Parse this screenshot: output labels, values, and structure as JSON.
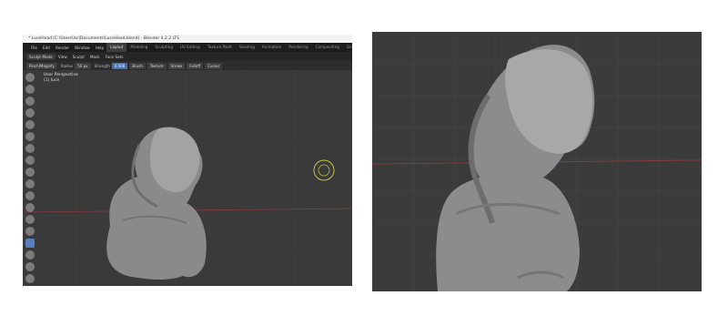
{
  "left_window": {
    "title": "* LuceHead [C:\\Users\\lsc\\Documents\\LuceHead.blend] - Blender 4.2.2 LTS",
    "top_menu": [
      {
        "label": "File"
      },
      {
        "label": "Edit"
      },
      {
        "label": "Render"
      },
      {
        "label": "Window"
      },
      {
        "label": "Help"
      }
    ],
    "workspace_tabs": [
      {
        "label": "Layout",
        "active": true
      },
      {
        "label": "Modeling",
        "active": false
      },
      {
        "label": "Sculpting",
        "active": false
      },
      {
        "label": "UV Editing",
        "active": false
      },
      {
        "label": "Texture Paint",
        "active": false
      },
      {
        "label": "Shading",
        "active": false
      },
      {
        "label": "Animation",
        "active": false
      },
      {
        "label": "Rendering",
        "active": false
      },
      {
        "label": "Compositing",
        "active": false
      },
      {
        "label": "Geometry Nodes",
        "active": false
      }
    ],
    "header": {
      "mode": "Sculpt Mode",
      "menus": [
        {
          "label": "View"
        },
        {
          "label": "Sculpt"
        },
        {
          "label": "Mask"
        },
        {
          "label": "Face Sets"
        }
      ]
    },
    "tool_settings": {
      "brush_name": "Pinch/Magnify",
      "radius_label": "Radius",
      "radius_value": "50 px",
      "strength_label": "Strength",
      "strength_value": "0.500",
      "dropdowns": [
        {
          "label": "Brush"
        },
        {
          "label": "Texture"
        },
        {
          "label": "Stroke"
        },
        {
          "label": "Falloff"
        },
        {
          "label": "Cursor"
        }
      ]
    },
    "viewport": {
      "view_name": "User Perspective",
      "object_name": "(1) luce"
    },
    "colors": {
      "accent": "#4772b3",
      "blender_orange": "#e87d0d",
      "viewport_bg": "#3a3a3a",
      "brush_cursor": "#c8c04a",
      "x_axis": "#8a3a3a"
    },
    "sculpt_tools": [
      {
        "icon": "draw-brush-icon",
        "active": false
      },
      {
        "icon": "draw-sharp-brush-icon",
        "active": false
      },
      {
        "icon": "clay-brush-icon",
        "active": false
      },
      {
        "icon": "clay-strips-brush-icon",
        "active": false
      },
      {
        "icon": "clay-thumb-brush-icon",
        "active": false
      },
      {
        "icon": "layer-brush-icon",
        "active": false
      },
      {
        "icon": "inflate-brush-icon",
        "active": false
      },
      {
        "icon": "blob-brush-icon",
        "active": false
      },
      {
        "icon": "crease-brush-icon",
        "active": false
      },
      {
        "icon": "smooth-brush-icon",
        "active": false
      },
      {
        "icon": "flatten-brush-icon",
        "active": false
      },
      {
        "icon": "fill-brush-icon",
        "active": false
      },
      {
        "icon": "scrape-brush-icon",
        "active": false
      },
      {
        "icon": "multiplane-scrape-brush-icon",
        "active": false
      },
      {
        "icon": "pinch-brush-icon",
        "active": true
      },
      {
        "icon": "grab-brush-icon",
        "active": false
      },
      {
        "icon": "elastic-deform-brush-icon",
        "active": false
      },
      {
        "icon": "snake-hook-brush-icon",
        "active": false
      },
      {
        "icon": "thumb-brush-icon",
        "active": false
      }
    ]
  },
  "right_viewport": {
    "colors": {
      "bg": "#3b3b3b",
      "x_axis": "#8a3a3a"
    }
  }
}
